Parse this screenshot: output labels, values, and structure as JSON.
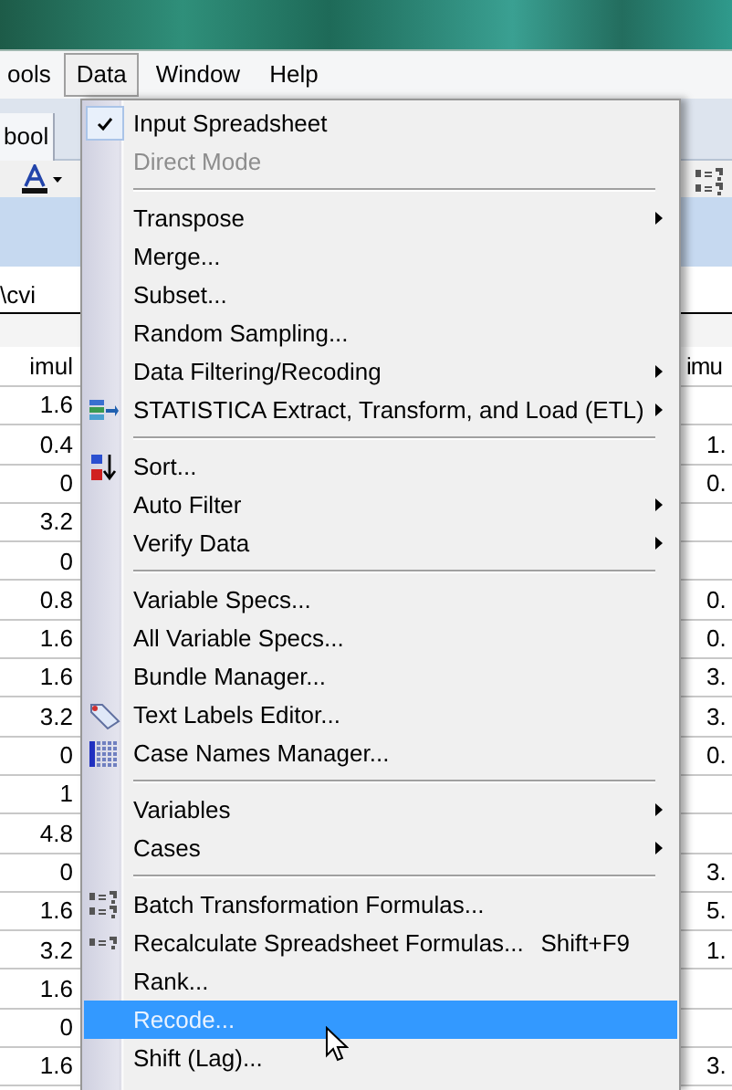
{
  "menu_bar": [
    {
      "label": "ools",
      "selected": false
    },
    {
      "label": "Data",
      "selected": true
    },
    {
      "label": "Window",
      "selected": false
    },
    {
      "label": "Help",
      "selected": false
    }
  ],
  "background": {
    "tab_label": "bool",
    "path_text": "\\cvi",
    "left_column": {
      "header": "imul",
      "cells": [
        "1.6",
        "0.4",
        "0",
        "3.2",
        "0",
        "0.8",
        "1.6",
        "1.6",
        "3.2",
        "0",
        "1",
        "4.8",
        "0",
        "1.6",
        "3.2",
        "1.6",
        "0",
        "1.6"
      ]
    },
    "right_column": {
      "header": "imu",
      "cells": [
        null,
        "1.",
        "0.",
        null,
        null,
        "0.",
        "0.",
        "3.",
        "3.",
        "0.",
        null,
        null,
        "3.",
        "5.",
        "1.",
        null,
        null,
        "3."
      ]
    }
  },
  "menu": {
    "items": [
      {
        "kind": "item",
        "label": "Input Spreadsheet",
        "checked": true,
        "disabled": false,
        "submenu": false,
        "selected": false
      },
      {
        "kind": "item",
        "label": "Direct Mode",
        "checked": false,
        "disabled": true,
        "submenu": false,
        "selected": false
      },
      {
        "kind": "separator"
      },
      {
        "kind": "item",
        "label": "Transpose",
        "checked": false,
        "disabled": false,
        "submenu": true,
        "selected": false
      },
      {
        "kind": "item",
        "label": "Merge...",
        "checked": false,
        "disabled": false,
        "submenu": false,
        "selected": false
      },
      {
        "kind": "item",
        "label": "Subset...",
        "checked": false,
        "disabled": false,
        "submenu": false,
        "selected": false
      },
      {
        "kind": "item",
        "label": "Random Sampling...",
        "checked": false,
        "disabled": false,
        "submenu": false,
        "selected": false
      },
      {
        "kind": "item",
        "label": "Data Filtering/Recoding",
        "checked": false,
        "disabled": false,
        "submenu": true,
        "selected": false
      },
      {
        "kind": "item",
        "label": "STATISTICA Extract, Transform, and Load (ETL)",
        "checked": false,
        "disabled": false,
        "submenu": true,
        "selected": false
      },
      {
        "kind": "separator"
      },
      {
        "kind": "item",
        "label": "Sort...",
        "checked": false,
        "disabled": false,
        "submenu": false,
        "selected": false
      },
      {
        "kind": "item",
        "label": "Auto Filter",
        "checked": false,
        "disabled": false,
        "submenu": true,
        "selected": false
      },
      {
        "kind": "item",
        "label": "Verify Data",
        "checked": false,
        "disabled": false,
        "submenu": true,
        "selected": false
      },
      {
        "kind": "separator"
      },
      {
        "kind": "item",
        "label": "Variable Specs...",
        "checked": false,
        "disabled": false,
        "submenu": false,
        "selected": false
      },
      {
        "kind": "item",
        "label": "All Variable Specs...",
        "checked": false,
        "disabled": false,
        "submenu": false,
        "selected": false
      },
      {
        "kind": "item",
        "label": "Bundle Manager...",
        "checked": false,
        "disabled": false,
        "submenu": false,
        "selected": false
      },
      {
        "kind": "item",
        "label": "Text Labels Editor...",
        "checked": false,
        "disabled": false,
        "submenu": false,
        "selected": false
      },
      {
        "kind": "item",
        "label": "Case Names Manager...",
        "checked": false,
        "disabled": false,
        "submenu": false,
        "selected": false
      },
      {
        "kind": "separator"
      },
      {
        "kind": "item",
        "label": "Variables",
        "checked": false,
        "disabled": false,
        "submenu": true,
        "selected": false
      },
      {
        "kind": "item",
        "label": "Cases",
        "checked": false,
        "disabled": false,
        "submenu": true,
        "selected": false
      },
      {
        "kind": "separator"
      },
      {
        "kind": "item",
        "label": "Batch Transformation Formulas...",
        "checked": false,
        "disabled": false,
        "submenu": false,
        "selected": false
      },
      {
        "kind": "item",
        "label": "Recalculate Spreadsheet Formulas...",
        "shortcut": "Shift+F9",
        "checked": false,
        "disabled": false,
        "submenu": false,
        "selected": false
      },
      {
        "kind": "item",
        "label": "Rank...",
        "checked": false,
        "disabled": false,
        "submenu": false,
        "selected": false
      },
      {
        "kind": "item",
        "label": "Recode...",
        "checked": false,
        "disabled": false,
        "submenu": false,
        "selected": true
      },
      {
        "kind": "item",
        "label": "Shift (Lag)...",
        "checked": false,
        "disabled": false,
        "submenu": false,
        "selected": false
      }
    ]
  }
}
